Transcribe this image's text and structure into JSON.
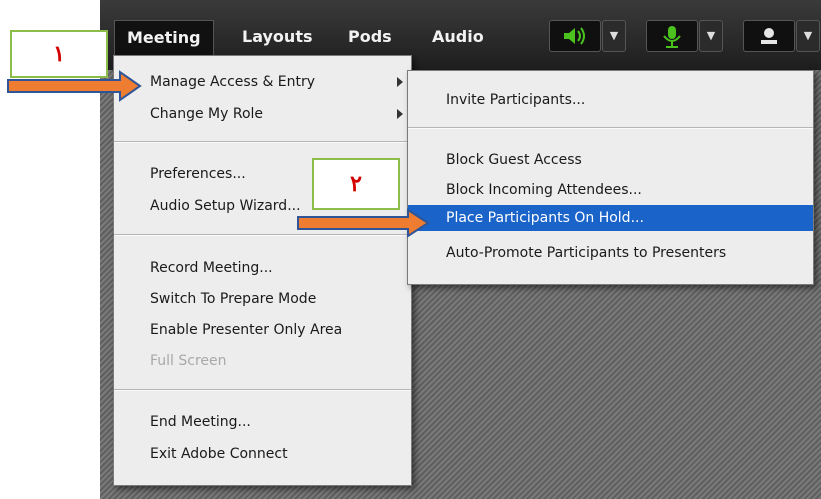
{
  "callouts": [
    "١",
    "٢"
  ],
  "menubar": {
    "items": [
      "Meeting",
      "Layouts",
      "Pods",
      "Audio"
    ],
    "icons": [
      "speaker-icon",
      "microphone-icon",
      "user-icon"
    ],
    "colors": {
      "speaker": "#4cc21f",
      "mic": "#4cc21f",
      "user": "#e6e6e6"
    }
  },
  "meeting_menu": {
    "items": [
      "Manage Access & Entry",
      "Change My Role",
      "Preferences...",
      "Audio Setup Wizard...",
      "Record Meeting...",
      "Switch To Prepare Mode",
      "Enable Presenter Only Area",
      "Full Screen",
      "End Meeting...",
      "Exit Adobe Connect"
    ],
    "disabled_index": 7
  },
  "submenu": {
    "items": [
      "Invite Participants...",
      "Block Guest Access",
      "Block Incoming Attendees...",
      "Place Participants On Hold...",
      "Auto-Promote Participants to Presenters"
    ],
    "highlighted_index": 3,
    "highlight_color": "#1a63c9"
  },
  "colors": {
    "arrow_fill": "#ef7d31",
    "arrow_stroke": "#2f5597",
    "callout_border": "#8cbd4a",
    "callout_text": "#d40000"
  }
}
